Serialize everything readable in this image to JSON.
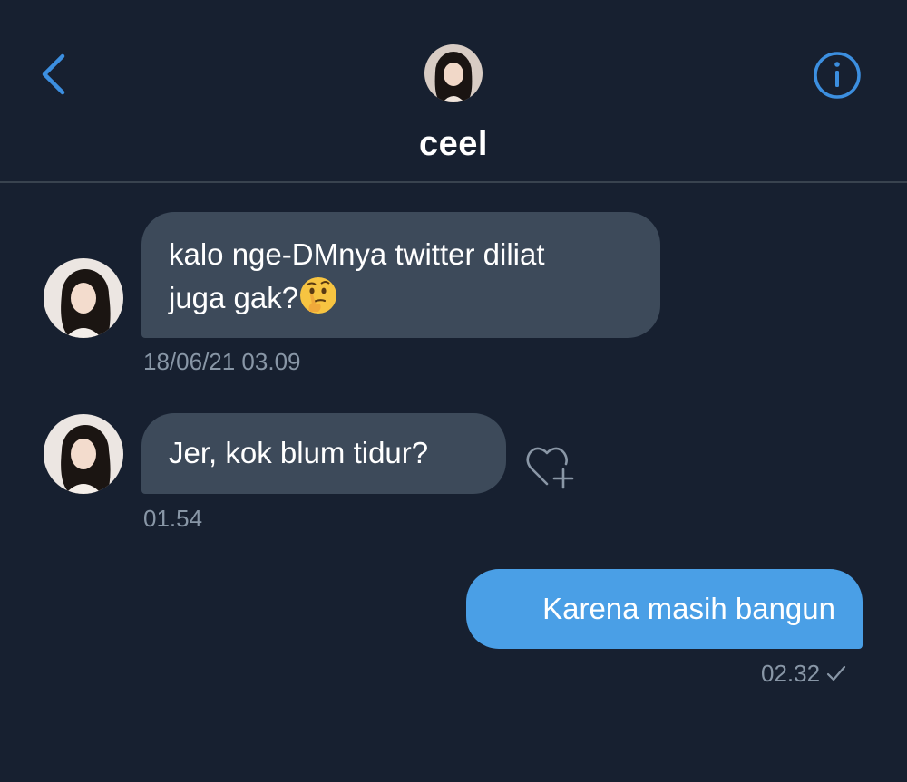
{
  "header": {
    "contact_name": "ceel",
    "back_icon": "chevron-left-icon",
    "info_icon": "info-circle-icon"
  },
  "messages": [
    {
      "direction": "incoming",
      "text_line1": "kalo nge-DMnya twitter diliat",
      "text_line2": "juga gak?",
      "emoji": "🤔",
      "timestamp": "18/06/21 03.09"
    },
    {
      "direction": "incoming",
      "text": "Jer, kok blum tidur?",
      "timestamp": "01.54",
      "reaction_icon": "heart-add-icon"
    },
    {
      "direction": "outgoing",
      "text": "Karena masih bangun",
      "timestamp": "02.32",
      "status_icon": "checkmark-icon"
    }
  ],
  "colors": {
    "background": "#172030",
    "incoming_bubble": "#3d4a5a",
    "outgoing_bubble": "#4a9fe6",
    "accent": "#3c8fe0",
    "timestamp": "#8896a6"
  }
}
